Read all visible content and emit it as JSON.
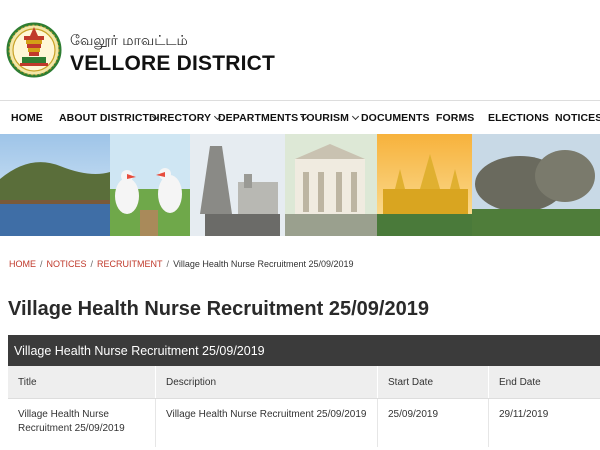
{
  "header": {
    "tamil_name": "வேலூர் மாவட்டம்",
    "district_name": "VELLORE DISTRICT"
  },
  "nav": {
    "items": [
      {
        "label": "HOME",
        "dropdown": false
      },
      {
        "label": "ABOUT DISTRICT",
        "dropdown": true
      },
      {
        "label": "DIRECTORY",
        "dropdown": true
      },
      {
        "label": "DEPARTMENTS",
        "dropdown": true
      },
      {
        "label": "TOURISM",
        "dropdown": true
      },
      {
        "label": "DOCUMENTS",
        "dropdown": false
      },
      {
        "label": "FORMS",
        "dropdown": false
      },
      {
        "label": "ELECTIONS",
        "dropdown": false
      },
      {
        "label": "NOTICES",
        "dropdown": true
      }
    ]
  },
  "breadcrumb": {
    "items": [
      "HOME",
      "NOTICES",
      "RECRUITMENT"
    ],
    "current": "Village Health Nurse Recruitment 25/09/2019"
  },
  "page_title": "Village Health Nurse Recruitment 25/09/2019",
  "table": {
    "caption": "Village Health Nurse Recruitment 25/09/2019",
    "headers": [
      "Title",
      "Description",
      "Start Date",
      "End Date"
    ],
    "rows": [
      {
        "title": "Village Health Nurse Recruitment 25/09/2019",
        "description": "Village Health Nurse Recruitment 25/09/2019",
        "start_date": "25/09/2019",
        "end_date": "29/11/2019"
      }
    ]
  },
  "colors": {
    "accent": "#c0392b",
    "table_caption_bg": "#3b3b3b",
    "table_header_bg": "#eeeeee"
  }
}
